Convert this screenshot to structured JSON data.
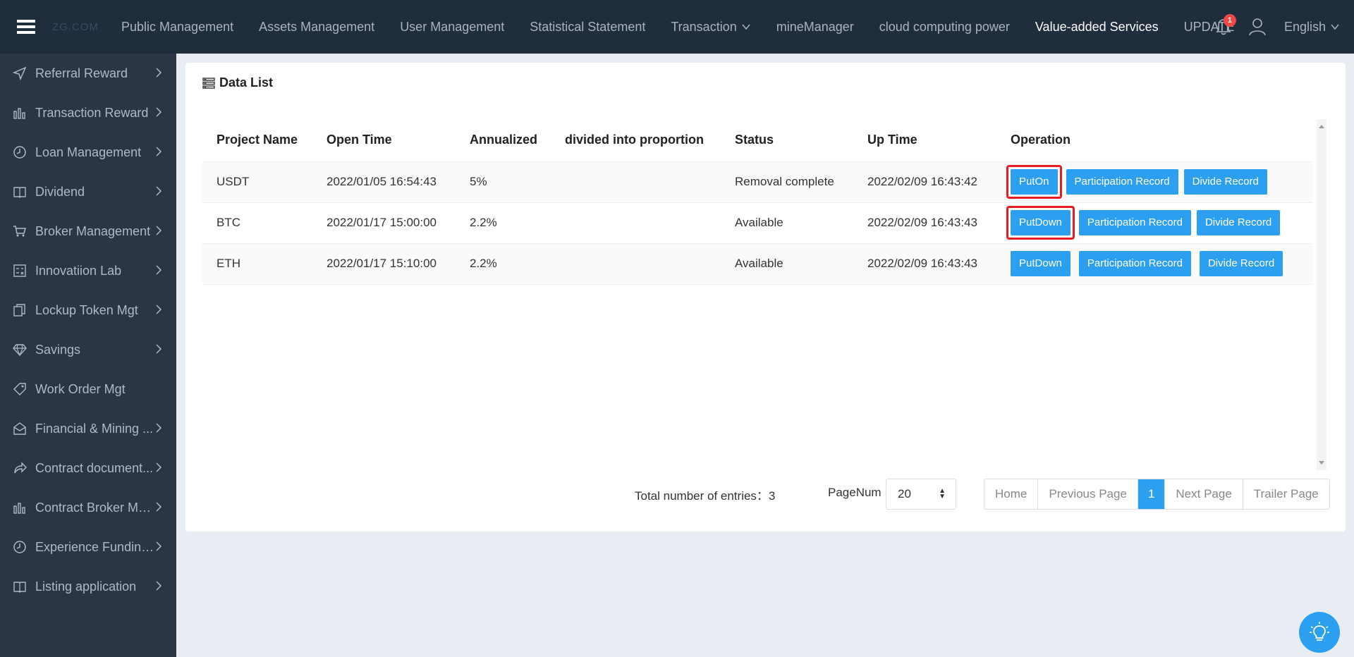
{
  "header": {
    "logo": "ZG.COM",
    "nav": [
      {
        "label": "Public Management"
      },
      {
        "label": "Assets Management"
      },
      {
        "label": "User Management"
      },
      {
        "label": "Statistical Statement"
      },
      {
        "label": "Transaction"
      },
      {
        "label": "mineManager"
      },
      {
        "label": "cloud computing power"
      },
      {
        "label": "Value-added Services"
      },
      {
        "label": "UPDATE"
      }
    ],
    "notification_count": "1",
    "language": "English"
  },
  "sidebar": {
    "items": [
      {
        "label": "Referral Reward",
        "icon": "send-icon"
      },
      {
        "label": "Transaction Reward",
        "icon": "bar-chart-icon"
      },
      {
        "label": "Loan Management",
        "icon": "clock-icon"
      },
      {
        "label": "Dividend",
        "icon": "book-icon"
      },
      {
        "label": "Broker Management",
        "icon": "cart-icon"
      },
      {
        "label": "Innovatiion Lab",
        "icon": "calculator-icon"
      },
      {
        "label": "Lockup Token Mgt",
        "icon": "copy-icon"
      },
      {
        "label": "Savings",
        "icon": "diamond-icon"
      },
      {
        "label": "Work Order Mgt",
        "icon": "tag-icon"
      },
      {
        "label": "Financial & Mining ...",
        "icon": "mail-open-icon"
      },
      {
        "label": "Contract document...",
        "icon": "share-icon"
      },
      {
        "label": "Contract Broker Mg...",
        "icon": "bar-chart-icon"
      },
      {
        "label": "Experience Funding...",
        "icon": "clock-icon"
      },
      {
        "label": "Listing application",
        "icon": "book-icon"
      }
    ]
  },
  "panel": {
    "title": "Data List",
    "columns": [
      "Project Name",
      "Open Time",
      "Annualized",
      "divided into proportion",
      "Status",
      "Up Time",
      "Operation"
    ],
    "rows": [
      {
        "name": "USDT",
        "open_time": "2022/01/05 16:54:43",
        "annualized": "5%",
        "proportion": "",
        "status": "Removal complete",
        "up_time": "2022/02/09 16:43:42",
        "toggle": "PutOn",
        "participation": "Participation Record",
        "divide": "Divide Record"
      },
      {
        "name": "BTC",
        "open_time": "2022/01/17 15:00:00",
        "annualized": "2.2%",
        "proportion": "",
        "status": "Available",
        "up_time": "2022/02/09 16:43:43",
        "toggle": "PutDown",
        "participation": "Participation Record",
        "divide": "Divide Record"
      },
      {
        "name": "ETH",
        "open_time": "2022/01/17 15:10:00",
        "annualized": "2.2%",
        "proportion": "",
        "status": "Available",
        "up_time": "2022/02/09 16:43:43",
        "toggle": "PutDown",
        "participation": "Participation Record",
        "divide": "Divide Record"
      }
    ]
  },
  "pagination": {
    "total_label": "Total number of entries：",
    "total": "3",
    "pagenum_label": "PageNum",
    "page_size": "20",
    "home": "Home",
    "prev": "Previous Page",
    "current": "1",
    "next": "Next Page",
    "trailer": "Trailer Page"
  },
  "colors": {
    "topbar": "#1f2d3d",
    "sidebar": "#2b3545",
    "accent": "#2d9ff0",
    "highlight": "#e51c23"
  }
}
